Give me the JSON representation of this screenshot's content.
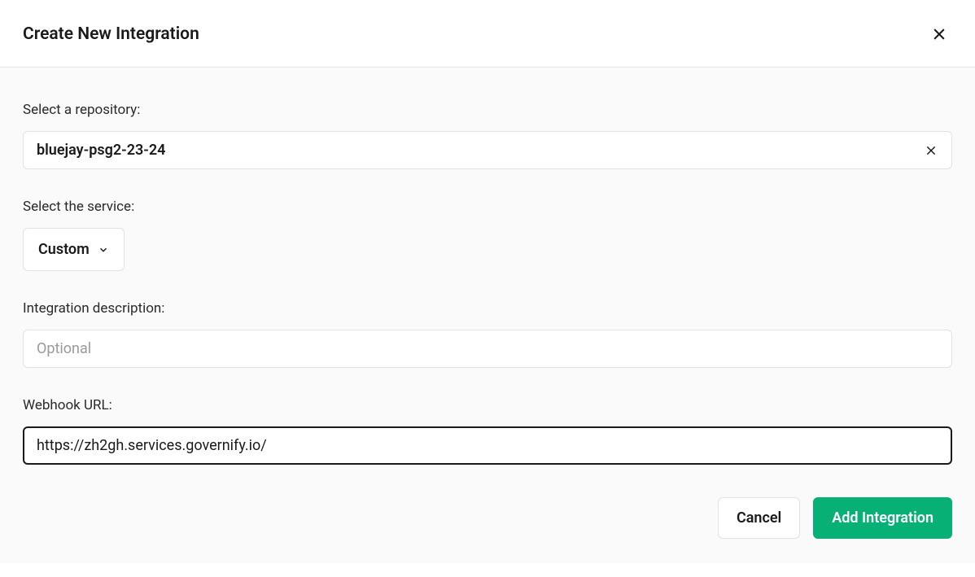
{
  "header": {
    "title": "Create New Integration"
  },
  "form": {
    "repository": {
      "label": "Select a repository:",
      "value": "bluejay-psg2-23-24"
    },
    "service": {
      "label": "Select the service:",
      "value": "Custom"
    },
    "description": {
      "label": "Integration description:",
      "placeholder": "Optional",
      "value": ""
    },
    "webhook": {
      "label": "Webhook URL:",
      "value": "https://zh2gh.services.governify.io/"
    }
  },
  "footer": {
    "cancel_label": "Cancel",
    "submit_label": "Add Integration"
  }
}
